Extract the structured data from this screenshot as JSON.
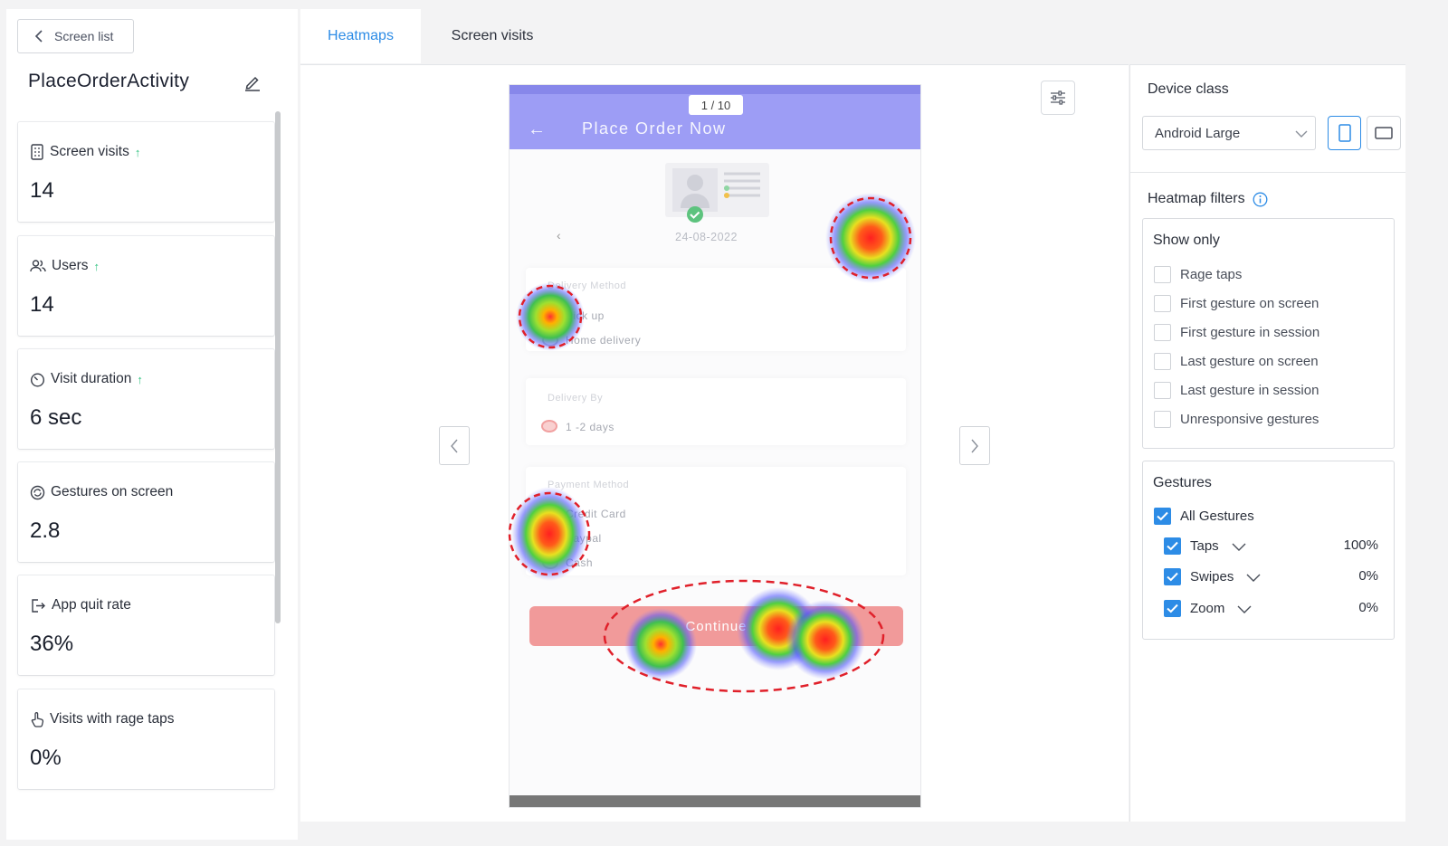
{
  "left": {
    "back_label": "Screen list",
    "title": "PlaceOrderActivity",
    "metrics": [
      {
        "label": "Screen visits",
        "value": "14",
        "trend": "up"
      },
      {
        "label": "Users",
        "value": "14",
        "trend": "up"
      },
      {
        "label": "Visit duration",
        "value": "6 sec",
        "trend": "up"
      },
      {
        "label": "Gestures on screen",
        "value": "2.8"
      },
      {
        "label": "App quit rate",
        "value": "36%"
      },
      {
        "label": "Visits with rage taps",
        "value": "0%"
      }
    ]
  },
  "tabs": [
    {
      "label": "Heatmaps",
      "active": true
    },
    {
      "label": "Screen visits",
      "active": false
    }
  ],
  "preview": {
    "counter": "1 / 10",
    "app_title": "Place Order Now",
    "date": "24-08-2022",
    "delivery_method_label": "Delivery Method",
    "delivery_options": [
      "Pick up",
      "Home delivery"
    ],
    "delivery_by_label": "Delivery By",
    "delivery_by_option": "1 -2 days",
    "payment_label": "Payment Method",
    "payment_options": [
      "Credit Card",
      "Paypal",
      "Cash"
    ],
    "continue_label": "Continue"
  },
  "right": {
    "device_class_title": "Device class",
    "device_selected": "Android Large",
    "filters_title": "Heatmap filters",
    "show_only_title": "Show only",
    "show_only": [
      {
        "label": "Rage taps",
        "checked": false
      },
      {
        "label": "First gesture on screen",
        "checked": false
      },
      {
        "label": "First gesture in session",
        "checked": false
      },
      {
        "label": "Last gesture on screen",
        "checked": false
      },
      {
        "label": "Last gesture in session",
        "checked": false
      },
      {
        "label": "Unresponsive gestures",
        "checked": false
      }
    ],
    "gestures_title": "Gestures",
    "all_gestures": {
      "label": "All Gestures",
      "checked": true
    },
    "gestures": [
      {
        "label": "Taps",
        "percent": "100%",
        "checked": true
      },
      {
        "label": "Swipes",
        "percent": "0%",
        "checked": true
      },
      {
        "label": "Zoom",
        "percent": "0%",
        "checked": true
      }
    ]
  },
  "colors": {
    "accent": "#2d8ce6",
    "trend_up": "#2ec27e",
    "app_bar": "#9d9df5",
    "highlight_ring": "#e0202a"
  }
}
